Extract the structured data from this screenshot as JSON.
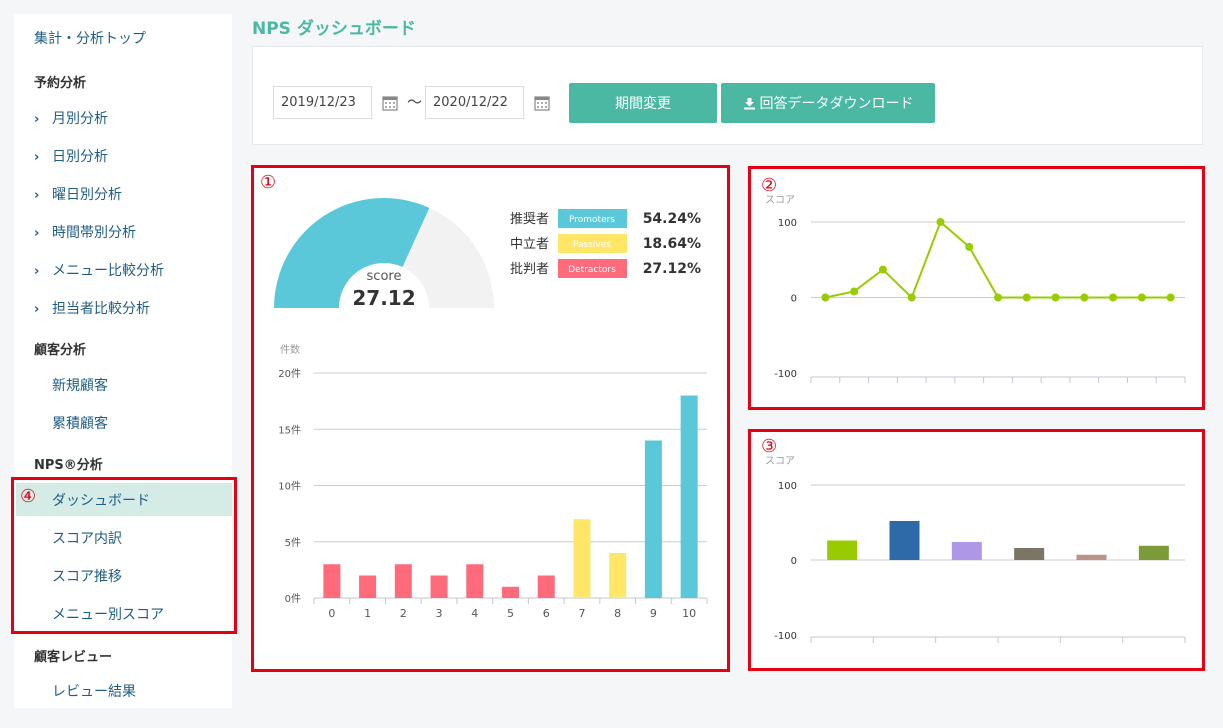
{
  "sidebar": {
    "top": "集計・分析トップ",
    "sections": [
      {
        "title": "予約分析",
        "items": [
          "月別分析",
          "日別分析",
          "曜日別分析",
          "時間帯別分析",
          "メニュー比較分析",
          "担当者比較分析"
        ]
      },
      {
        "title": "顧客分析",
        "items": [
          "新規顧客",
          "累積顧客"
        ]
      },
      {
        "title": "NPS®分析",
        "items": [
          "ダッシュボード",
          "スコア内訳",
          "スコア推移",
          "メニュー別スコア"
        ]
      },
      {
        "title": "顧客レビュー",
        "items": [
          "レビュー結果"
        ]
      }
    ],
    "chevron": "›"
  },
  "page": {
    "title": "NPS ダッシュボード"
  },
  "filter": {
    "start_date": "2019/12/23",
    "end_date": "2020/12/22",
    "separator": "〜",
    "change_button": "期間変更",
    "download_button": "回答データダウンロード",
    "download_icon": "download-icon",
    "calendar_icon": "calendar-icon"
  },
  "annotations": {
    "one": "①",
    "two": "②",
    "three": "③",
    "four": "④"
  },
  "colors": {
    "accent": "#4bb8a4",
    "promoters": "#5ac8d8",
    "passives": "#ffe666",
    "detractors": "#ff6b7a",
    "trend_line": "#99cc00",
    "highlight_border": "#e60012"
  },
  "nps": {
    "score_label": "score",
    "score_value": "27.12",
    "score": 27.12,
    "legend": [
      {
        "label": "推奨者",
        "badge": "Promoters",
        "value": "54.24%",
        "color": "#5ac8d8"
      },
      {
        "label": "中立者",
        "badge": "Passives",
        "value": "18.64%",
        "color": "#ffe666"
      },
      {
        "label": "批判者",
        "badge": "Detractors",
        "value": "27.12%",
        "color": "#ff6b7a"
      }
    ]
  },
  "chart_data": [
    {
      "type": "bar",
      "ylabel": "件数",
      "ylim": [
        0,
        20
      ],
      "yticks": [
        "0件",
        "5件",
        "10件",
        "15件",
        "20件"
      ],
      "ytick_values": [
        0,
        5,
        10,
        15,
        20
      ],
      "categories": [
        "0",
        "1",
        "2",
        "3",
        "4",
        "5",
        "6",
        "7",
        "8",
        "9",
        "10"
      ],
      "values": [
        3,
        2,
        3,
        2,
        3,
        1,
        2,
        7,
        4,
        14,
        18
      ],
      "colors": [
        "#ff6b7a",
        "#ff6b7a",
        "#ff6b7a",
        "#ff6b7a",
        "#ff6b7a",
        "#ff6b7a",
        "#ff6b7a",
        "#ffe666",
        "#ffe666",
        "#5ac8d8",
        "#5ac8d8"
      ],
      "grid": true
    },
    {
      "type": "line",
      "ylabel": "スコア",
      "ylim": [
        -100,
        100
      ],
      "yticks": [
        "100",
        "0",
        "-100"
      ],
      "ytick_values": [
        100,
        0,
        -100
      ],
      "values": [
        0,
        8,
        37,
        0,
        100,
        67,
        0,
        0,
        0,
        0,
        0,
        0,
        0
      ],
      "color": "#99cc00",
      "grid": true
    },
    {
      "type": "bar",
      "ylabel": "スコア",
      "ylim": [
        -100,
        100
      ],
      "yticks": [
        "100",
        "0",
        "-100"
      ],
      "ytick_values": [
        100,
        0,
        -100
      ],
      "values": [
        26,
        52,
        24,
        16,
        7,
        19
      ],
      "colors": [
        "#99cc00",
        "#2e6aa8",
        "#ad97e6",
        "#7b7566",
        "#b8948a",
        "#7d9a3a"
      ],
      "grid": true
    }
  ]
}
